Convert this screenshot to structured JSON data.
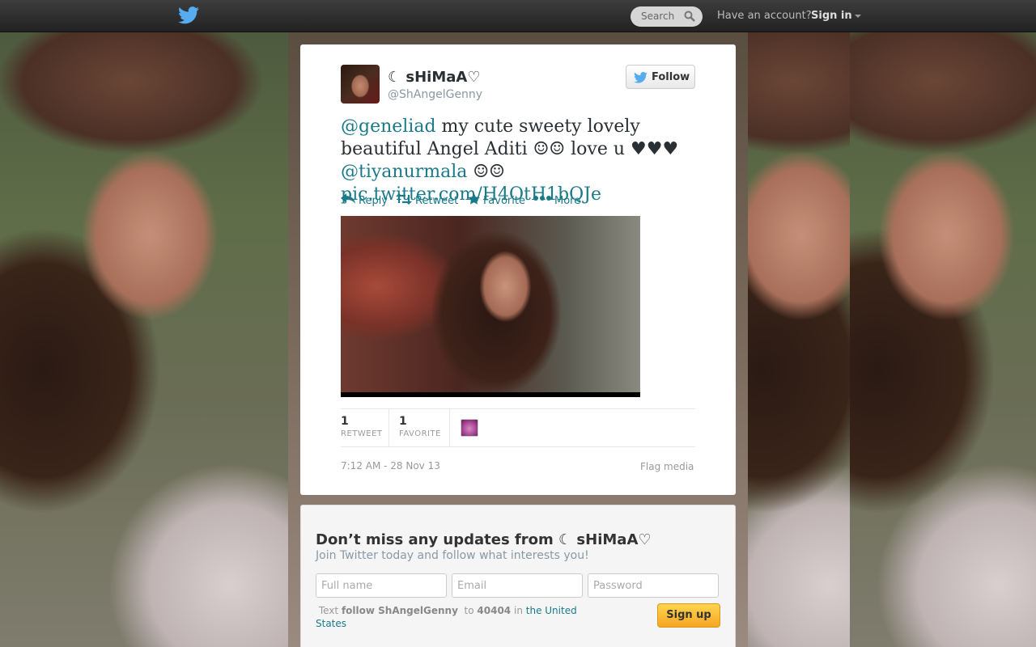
{
  "topbar": {
    "search_placeholder": "Search",
    "have_account": "Have an account?",
    "sign_in": "Sign in"
  },
  "tweet": {
    "display_name": "☾ sHiMaA♡",
    "handle": "@ShAngelGenny",
    "follow_label": "Follow",
    "text": {
      "mention1": "@geneliad",
      "part1": " my cute sweety lovely beautiful Angel Aditi ☺☺ love u ♥♥♥ ",
      "mention2": "@tiyanurmala",
      "part2": " ☺☺ ",
      "link": "pic.twitter.com/H4OtH1bQJe"
    },
    "actions": {
      "reply": "Reply",
      "retweet": "Retweet",
      "favorite": "Favorite",
      "more": "More"
    },
    "stats": {
      "retweets": "1",
      "retweets_label": "RETWEET",
      "favorites": "1",
      "favorites_label": "FAVORITE"
    },
    "timestamp": "7:12 AM - 28 Nov 13",
    "flag_media": "Flag media"
  },
  "signup": {
    "title": "Don’t miss any updates from ☾ sHiMaA♡",
    "subtitle": "Join Twitter today and follow what interests you!",
    "full_name_placeholder": "Full name",
    "email_placeholder": "Email",
    "password_placeholder": "Password",
    "sms_text": "Text",
    "sms_command": "follow ShAngelGenny",
    "sms_to": "to",
    "sms_number": "40404",
    "sms_in": "in",
    "sms_region": "the United States",
    "sign_up_label": "Sign up"
  },
  "colors": {
    "link": "#1a7a8a",
    "topbar": "#2b2b2b",
    "signup_button": "#f5a623"
  }
}
